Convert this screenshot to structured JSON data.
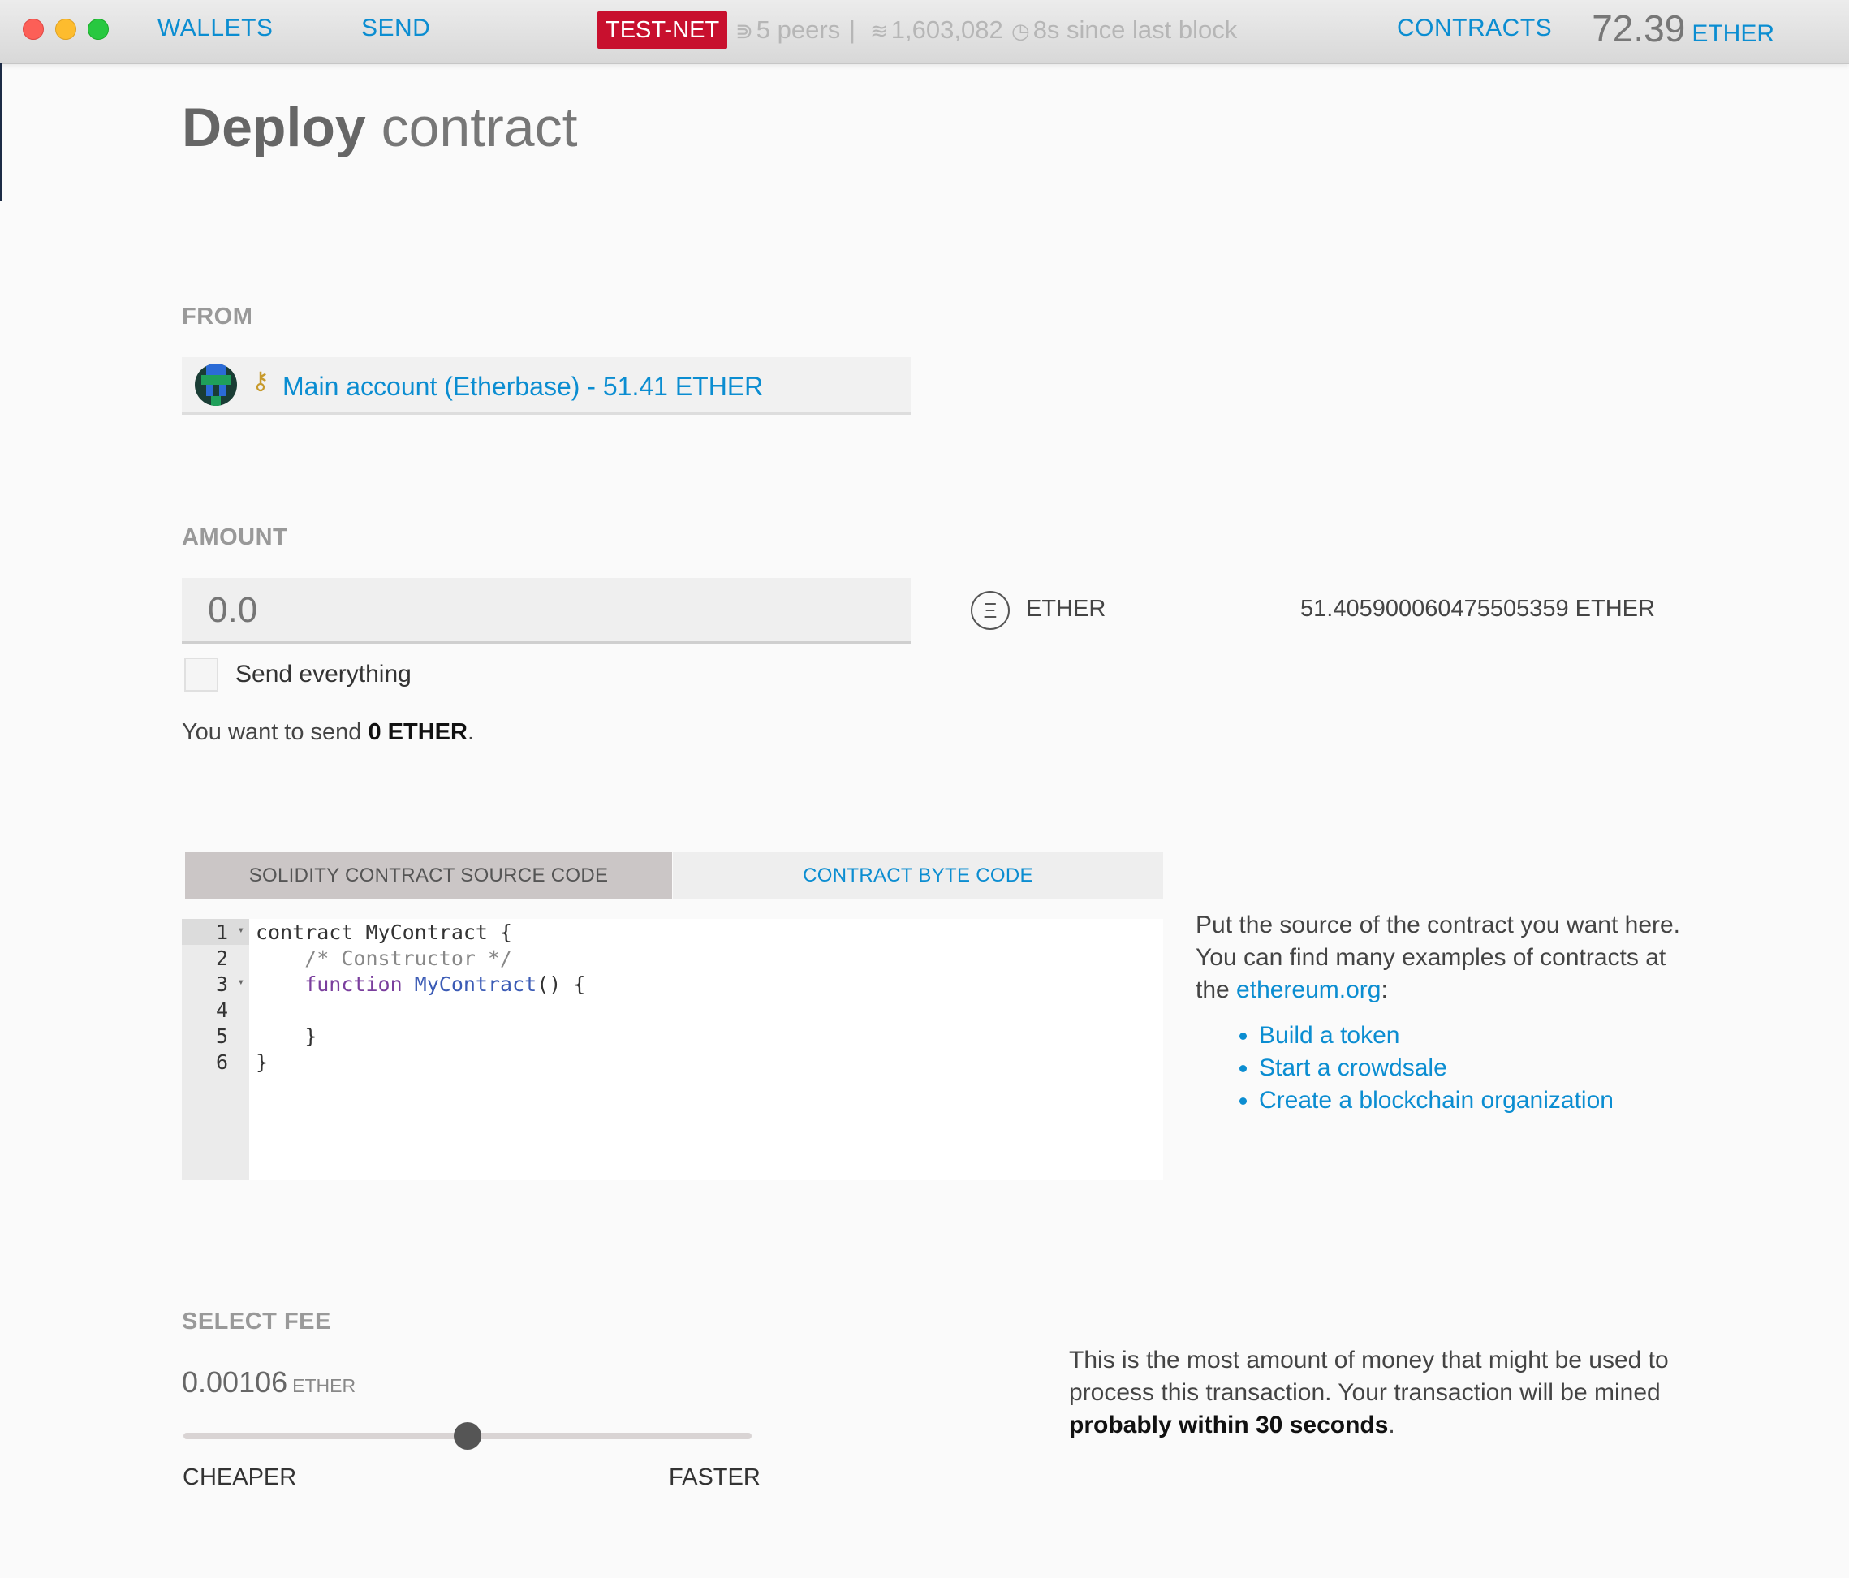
{
  "nav": {
    "wallets": "WALLETS",
    "send": "SEND",
    "network_badge": "TEST-NET",
    "peers": "5 peers",
    "separator": "|",
    "block": "1,603,082",
    "since_block": "8s since last block",
    "contracts": "CONTRACTS",
    "balance": "72.39",
    "balance_unit": "ETHER"
  },
  "page": {
    "title_bold": "Deploy",
    "title_rest": " contract"
  },
  "from": {
    "label": "FROM",
    "account": "Main account (Etherbase) - 51.41 ETHER"
  },
  "amount": {
    "label": "AMOUNT",
    "placeholder": "0.0",
    "currency_symbol": "Ξ",
    "currency": "ETHER",
    "available": "51.405900060475505359 ETHER",
    "send_everything": "Send everything",
    "summary_prefix": "You want to send ",
    "summary_value": "0 ETHER",
    "summary_suffix": "."
  },
  "tabs": {
    "source": "SOLIDITY CONTRACT SOURCE CODE",
    "bytecode": "CONTRACT BYTE CODE"
  },
  "editor": {
    "lines": [
      "1",
      "2",
      "3",
      "4",
      "5",
      "6"
    ],
    "line1": "contract MyContract {",
    "line2": "    /* Constructor */",
    "line3_kw": "    function ",
    "line3_fn": "MyContract",
    "line3_rest": "() {",
    "line4": "",
    "line5": "    }",
    "line6": "}"
  },
  "help": {
    "text1": "Put the source of the contract you want here. You can find many examples of contracts at the ",
    "link": "ethereum.org",
    "text2": ":",
    "examples": [
      "Build a token",
      "Start a crowdsale",
      "Create a blockchain organization"
    ]
  },
  "fee": {
    "label": "SELECT FEE",
    "amount": "0.00106",
    "unit": "ETHER",
    "slider_position": 0.5,
    "cheaper": "CHEAPER",
    "faster": "FASTER",
    "info_text": "This is the most amount of money that might be used to process this transaction. Your transaction will be mined ",
    "info_bold": "probably within 30 seconds",
    "info_end": "."
  }
}
